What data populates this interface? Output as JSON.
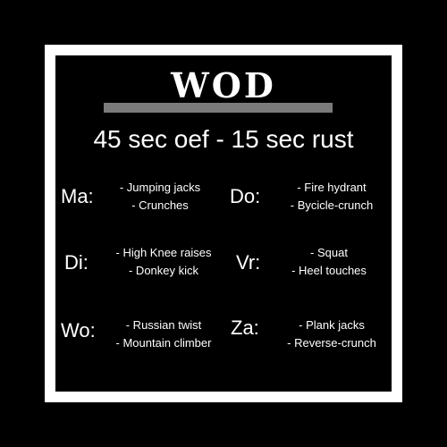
{
  "title": "WOD",
  "subtitle": "45 sec oef - 15 sec rust",
  "colors": {
    "background": "#000000",
    "frame": "#ffffff",
    "divider": "#7a7a7a",
    "text": "#ffffff"
  },
  "days": {
    "ma": {
      "label": "Ma:",
      "exercises": [
        "- Jumping jacks",
        "- Crunches"
      ]
    },
    "di": {
      "label": "Di:",
      "exercises": [
        "- High Knee raises",
        "- Donkey kick"
      ]
    },
    "wo": {
      "label": "Wo:",
      "exercises": [
        "- Russian twist",
        "- Mountain climber"
      ]
    },
    "do": {
      "label": "Do:",
      "exercises": [
        "- Fire hydrant",
        "- Bycicle-crunch"
      ]
    },
    "vr": {
      "label": "Vr:",
      "exercises": [
        "- Squat",
        "- Heel touches"
      ]
    },
    "za": {
      "label": "Za:",
      "exercises": [
        "- Plank jacks",
        "- Reverse-crunch"
      ]
    }
  }
}
